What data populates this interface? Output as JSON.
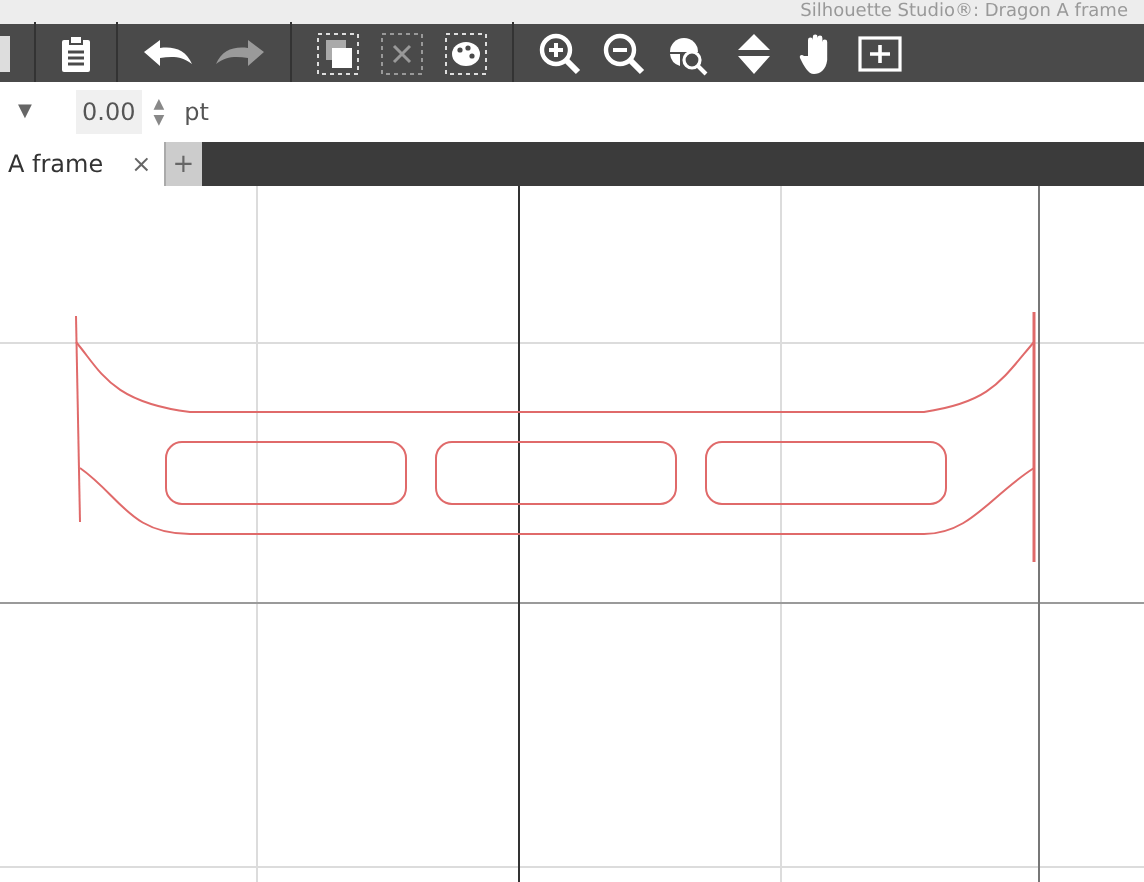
{
  "window": {
    "title": "Silhouette Studio®: Dragon A frame"
  },
  "options_bar": {
    "dropdown_caret": "▼",
    "value": "0.00",
    "up": "▲",
    "down": "▼",
    "unit": "pt"
  },
  "tabs": [
    {
      "label": "A frame",
      "selected": true,
      "close": "×"
    }
  ],
  "add_tab": "+"
}
